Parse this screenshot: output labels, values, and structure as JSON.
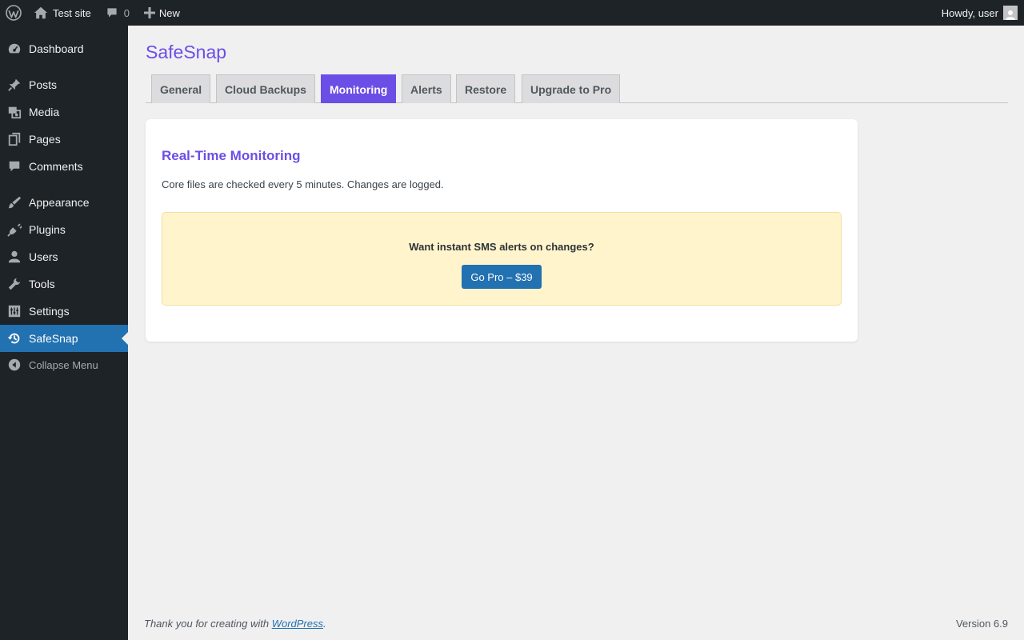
{
  "adminbar": {
    "site_name": "Test site",
    "comments_count": "0",
    "new_label": "New",
    "howdy": "Howdy, user"
  },
  "sidebar": {
    "items": [
      {
        "label": "Dashboard",
        "icon": "dashboard-icon"
      },
      {
        "label": "Posts",
        "icon": "pin-icon"
      },
      {
        "label": "Media",
        "icon": "media-icon"
      },
      {
        "label": "Pages",
        "icon": "pages-icon"
      },
      {
        "label": "Comments",
        "icon": "comment-icon"
      },
      {
        "label": "Appearance",
        "icon": "brush-icon"
      },
      {
        "label": "Plugins",
        "icon": "plug-icon"
      },
      {
        "label": "Users",
        "icon": "user-icon"
      },
      {
        "label": "Tools",
        "icon": "wrench-icon"
      },
      {
        "label": "Settings",
        "icon": "sliders-icon"
      },
      {
        "label": "SafeSnap",
        "icon": "history-icon"
      }
    ],
    "collapse_label": "Collapse Menu"
  },
  "page": {
    "title": "SafeSnap",
    "tabs": [
      "General",
      "Cloud Backups",
      "Monitoring",
      "Alerts",
      "Restore",
      "Upgrade to Pro"
    ],
    "active_tab": "Monitoring"
  },
  "card": {
    "heading": "Real-Time Monitoring",
    "description": "Core files are checked every 5 minutes. Changes are logged.",
    "promo_question": "Want instant SMS alerts on changes?",
    "promo_button": "Go Pro – $39"
  },
  "footer": {
    "thanks_prefix": "Thank you for creating with ",
    "thanks_link": "WordPress",
    "thanks_suffix": ".",
    "version": "Version 6.9"
  },
  "colors": {
    "accent": "#6b4ee6",
    "wp_blue": "#2271b1",
    "adminbar": "#1d2327",
    "promo_bg": "#fff4cc"
  }
}
